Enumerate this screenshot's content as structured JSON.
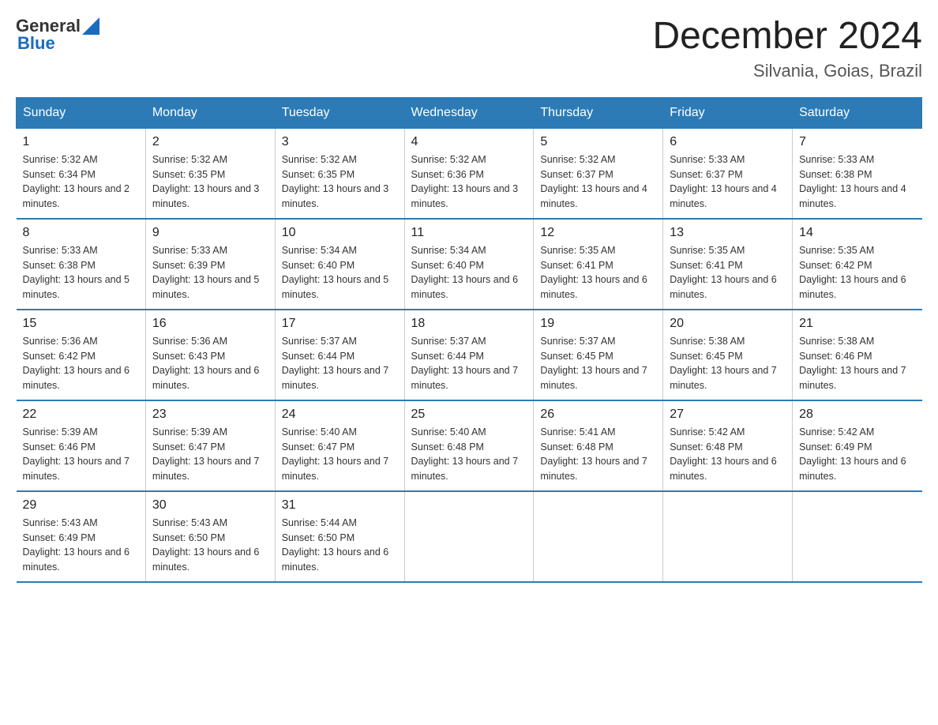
{
  "header": {
    "logo_general": "General",
    "logo_blue": "Blue",
    "title": "December 2024",
    "subtitle": "Silvania, Goias, Brazil"
  },
  "weekdays": [
    "Sunday",
    "Monday",
    "Tuesday",
    "Wednesday",
    "Thursday",
    "Friday",
    "Saturday"
  ],
  "weeks": [
    [
      {
        "day": "1",
        "sunrise": "5:32 AM",
        "sunset": "6:34 PM",
        "daylight": "13 hours and 2 minutes."
      },
      {
        "day": "2",
        "sunrise": "5:32 AM",
        "sunset": "6:35 PM",
        "daylight": "13 hours and 3 minutes."
      },
      {
        "day": "3",
        "sunrise": "5:32 AM",
        "sunset": "6:35 PM",
        "daylight": "13 hours and 3 minutes."
      },
      {
        "day": "4",
        "sunrise": "5:32 AM",
        "sunset": "6:36 PM",
        "daylight": "13 hours and 3 minutes."
      },
      {
        "day": "5",
        "sunrise": "5:32 AM",
        "sunset": "6:37 PM",
        "daylight": "13 hours and 4 minutes."
      },
      {
        "day": "6",
        "sunrise": "5:33 AM",
        "sunset": "6:37 PM",
        "daylight": "13 hours and 4 minutes."
      },
      {
        "day": "7",
        "sunrise": "5:33 AM",
        "sunset": "6:38 PM",
        "daylight": "13 hours and 4 minutes."
      }
    ],
    [
      {
        "day": "8",
        "sunrise": "5:33 AM",
        "sunset": "6:38 PM",
        "daylight": "13 hours and 5 minutes."
      },
      {
        "day": "9",
        "sunrise": "5:33 AM",
        "sunset": "6:39 PM",
        "daylight": "13 hours and 5 minutes."
      },
      {
        "day": "10",
        "sunrise": "5:34 AM",
        "sunset": "6:40 PM",
        "daylight": "13 hours and 5 minutes."
      },
      {
        "day": "11",
        "sunrise": "5:34 AM",
        "sunset": "6:40 PM",
        "daylight": "13 hours and 6 minutes."
      },
      {
        "day": "12",
        "sunrise": "5:35 AM",
        "sunset": "6:41 PM",
        "daylight": "13 hours and 6 minutes."
      },
      {
        "day": "13",
        "sunrise": "5:35 AM",
        "sunset": "6:41 PM",
        "daylight": "13 hours and 6 minutes."
      },
      {
        "day": "14",
        "sunrise": "5:35 AM",
        "sunset": "6:42 PM",
        "daylight": "13 hours and 6 minutes."
      }
    ],
    [
      {
        "day": "15",
        "sunrise": "5:36 AM",
        "sunset": "6:42 PM",
        "daylight": "13 hours and 6 minutes."
      },
      {
        "day": "16",
        "sunrise": "5:36 AM",
        "sunset": "6:43 PM",
        "daylight": "13 hours and 6 minutes."
      },
      {
        "day": "17",
        "sunrise": "5:37 AM",
        "sunset": "6:44 PM",
        "daylight": "13 hours and 7 minutes."
      },
      {
        "day": "18",
        "sunrise": "5:37 AM",
        "sunset": "6:44 PM",
        "daylight": "13 hours and 7 minutes."
      },
      {
        "day": "19",
        "sunrise": "5:37 AM",
        "sunset": "6:45 PM",
        "daylight": "13 hours and 7 minutes."
      },
      {
        "day": "20",
        "sunrise": "5:38 AM",
        "sunset": "6:45 PM",
        "daylight": "13 hours and 7 minutes."
      },
      {
        "day": "21",
        "sunrise": "5:38 AM",
        "sunset": "6:46 PM",
        "daylight": "13 hours and 7 minutes."
      }
    ],
    [
      {
        "day": "22",
        "sunrise": "5:39 AM",
        "sunset": "6:46 PM",
        "daylight": "13 hours and 7 minutes."
      },
      {
        "day": "23",
        "sunrise": "5:39 AM",
        "sunset": "6:47 PM",
        "daylight": "13 hours and 7 minutes."
      },
      {
        "day": "24",
        "sunrise": "5:40 AM",
        "sunset": "6:47 PM",
        "daylight": "13 hours and 7 minutes."
      },
      {
        "day": "25",
        "sunrise": "5:40 AM",
        "sunset": "6:48 PM",
        "daylight": "13 hours and 7 minutes."
      },
      {
        "day": "26",
        "sunrise": "5:41 AM",
        "sunset": "6:48 PM",
        "daylight": "13 hours and 7 minutes."
      },
      {
        "day": "27",
        "sunrise": "5:42 AM",
        "sunset": "6:48 PM",
        "daylight": "13 hours and 6 minutes."
      },
      {
        "day": "28",
        "sunrise": "5:42 AM",
        "sunset": "6:49 PM",
        "daylight": "13 hours and 6 minutes."
      }
    ],
    [
      {
        "day": "29",
        "sunrise": "5:43 AM",
        "sunset": "6:49 PM",
        "daylight": "13 hours and 6 minutes."
      },
      {
        "day": "30",
        "sunrise": "5:43 AM",
        "sunset": "6:50 PM",
        "daylight": "13 hours and 6 minutes."
      },
      {
        "day": "31",
        "sunrise": "5:44 AM",
        "sunset": "6:50 PM",
        "daylight": "13 hours and 6 minutes."
      },
      null,
      null,
      null,
      null
    ]
  ]
}
